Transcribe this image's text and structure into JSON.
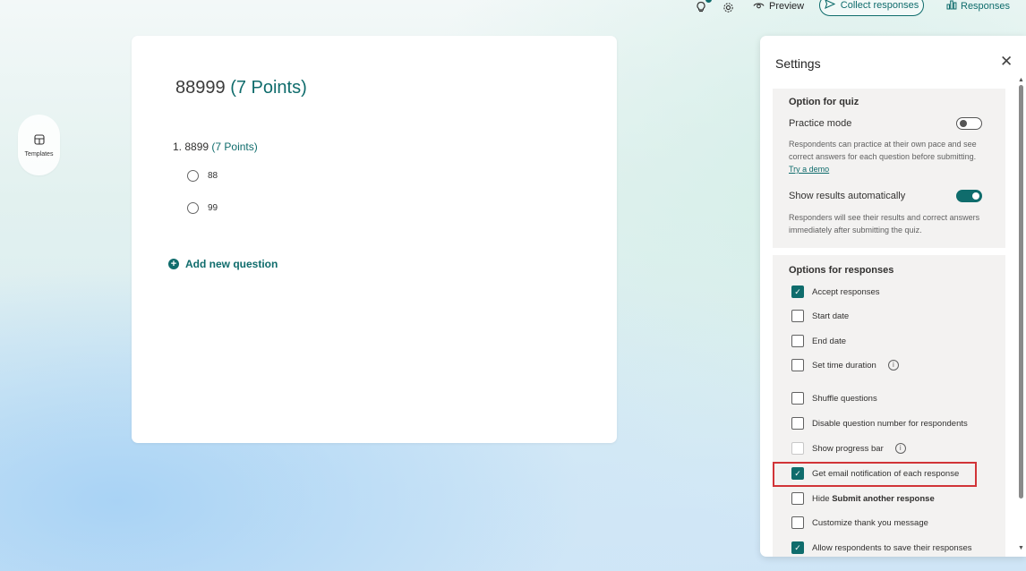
{
  "topbar": {
    "preview_label": "Preview",
    "collect_label": "Collect responses",
    "responses_label": "Responses"
  },
  "sidebar": {
    "templates_label": "Templates"
  },
  "form": {
    "title": "88999",
    "title_points": "(7 Points)",
    "question": {
      "label": "1. 8899",
      "points": "(7 Points)",
      "options": [
        "88",
        "99"
      ]
    },
    "add_question_label": "Add new question"
  },
  "settings": {
    "title": "Settings",
    "quiz": {
      "heading": "Option for quiz",
      "practice_mode_label": "Practice mode",
      "practice_mode_on": false,
      "practice_desc": "Respondents can practice at their own pace and see correct answers for each question before submitting.",
      "practice_link": "Try a demo",
      "show_results_label": "Show results automatically",
      "show_results_on": true,
      "show_results_desc": "Responders will see their results and correct answers immediately after submitting the quiz."
    },
    "responses": {
      "heading": "Options for responses",
      "items": [
        {
          "label": "Accept responses",
          "checked": true
        },
        {
          "label": "Start date",
          "checked": false
        },
        {
          "label": "End date",
          "checked": false
        },
        {
          "label": "Set time duration",
          "checked": false
        },
        {
          "label": "Shuffle questions",
          "checked": false
        },
        {
          "label": "Disable question number for respondents",
          "checked": false
        },
        {
          "label": "Show progress bar",
          "checked": false
        },
        {
          "label": "Get email notification of each response",
          "checked": true
        },
        {
          "label_prefix": "Hide",
          "label_bold": "Submit another response",
          "checked": false
        },
        {
          "label": "Customize thank you message",
          "checked": false
        },
        {
          "label": "Allow respondents to save their responses",
          "checked": true
        }
      ]
    }
  },
  "colors": {
    "accent": "#0f6c6c",
    "highlight": "#d13438"
  }
}
